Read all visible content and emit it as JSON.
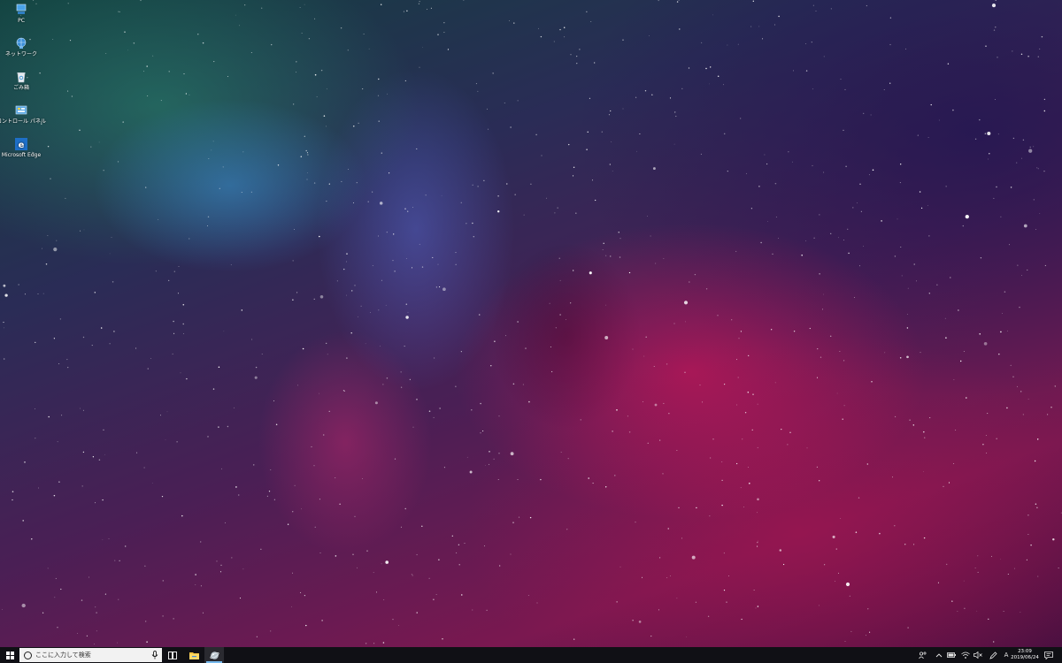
{
  "desktop": {
    "icons": [
      {
        "label": "PC",
        "icon": "pc-icon"
      },
      {
        "label": "ネットワーク",
        "icon": "network-icon"
      },
      {
        "label": "ごみ箱",
        "icon": "recycle-bin-icon"
      },
      {
        "label": "コントロール パネル",
        "icon": "control-panel-icon"
      },
      {
        "label": "Microsoft Edge",
        "icon": "edge-icon"
      }
    ]
  },
  "taskbar": {
    "search_placeholder": "ここに入力して検索",
    "pinned": [
      {
        "name": "task-view",
        "icon": "task-view-icon"
      },
      {
        "name": "file-explorer",
        "icon": "folder-icon"
      },
      {
        "name": "app",
        "icon": "app-icon",
        "active": true
      }
    ],
    "tray": {
      "ime_mode": "A",
      "clock_time": "23:09",
      "clock_date": "2019/06/24"
    }
  },
  "colors": {
    "taskbar": "#101015",
    "search_box": "#f2f2f2",
    "active_indicator": "#76b9ed",
    "edge_blue": "#1e6fc7"
  }
}
